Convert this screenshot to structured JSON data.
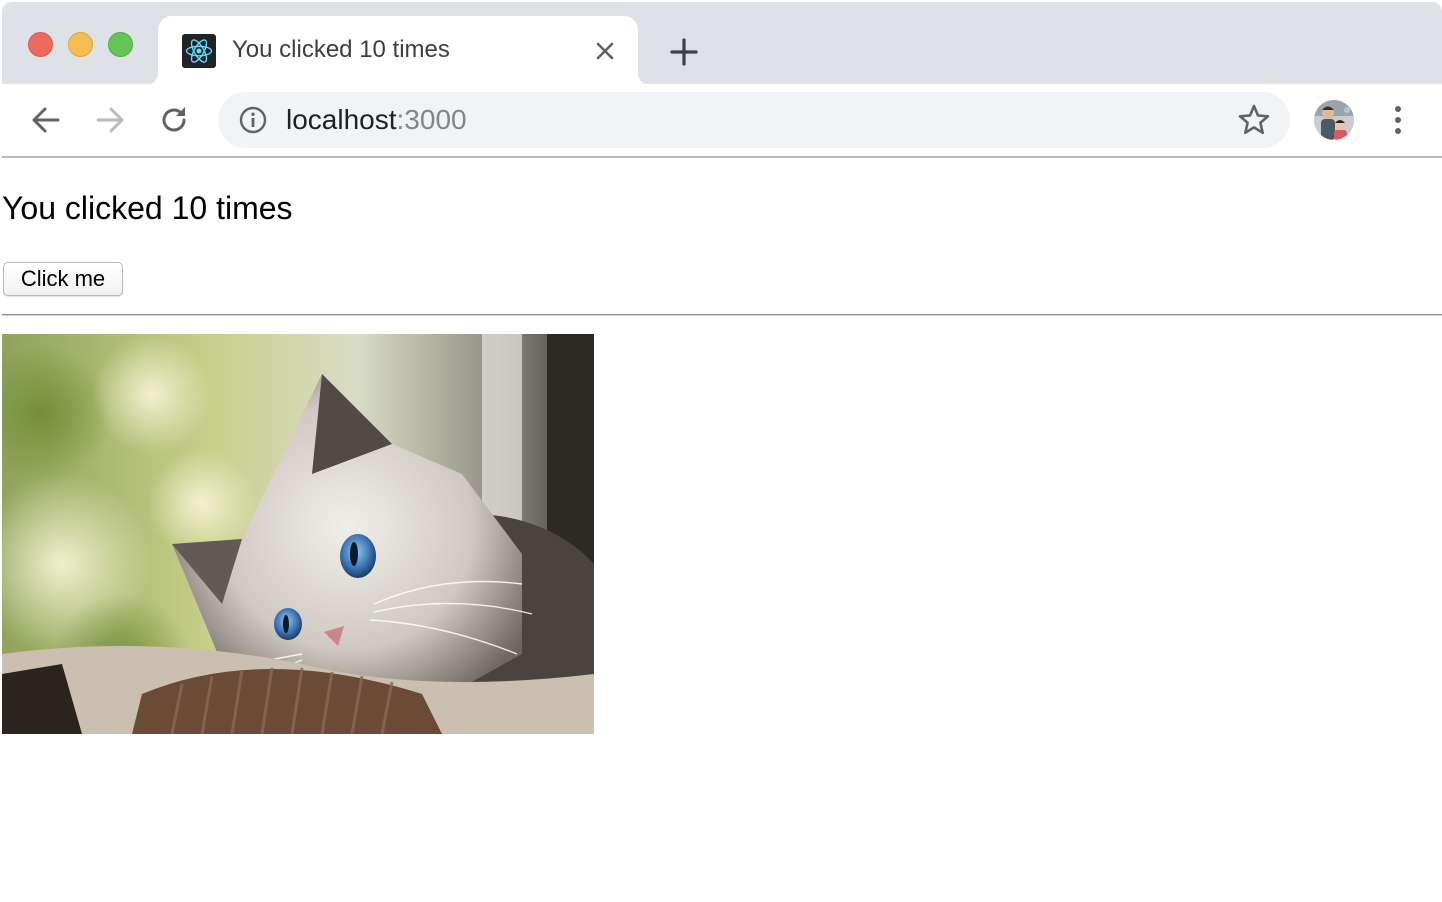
{
  "tab": {
    "title": "You clicked 10 times",
    "favicon": "react-logo-icon"
  },
  "toolbar": {
    "url_host": "localhost",
    "url_port": ":3000"
  },
  "page": {
    "counter_text": "You clicked 10 times",
    "button_label": "Click me"
  },
  "colors": {
    "tabstrip": "#dee1e6",
    "omnibox": "#f1f3f4",
    "react_accent": "#61dafb"
  }
}
